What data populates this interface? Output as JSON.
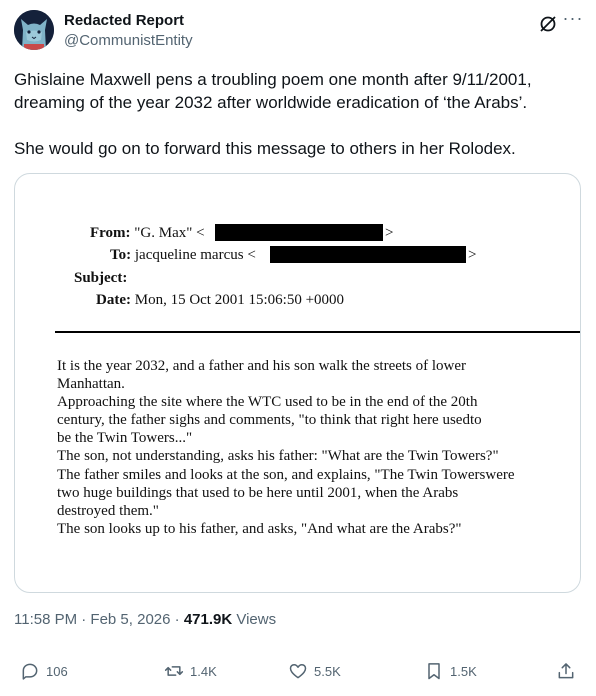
{
  "author": {
    "name": "Redacted Report",
    "handle": "@CommunistEntity"
  },
  "tweet": {
    "text_line1": "Ghislaine Maxwell pens a troubling poem one month after 9/11/2001,",
    "text_line2": "dreaming of the year 2032 after worldwide eradication of ‘the Arabs’.",
    "text_line3": "She would go on to forward this message to others in her Rolodex."
  },
  "email": {
    "from_label": "From:",
    "from_value": "\"G. Max\" <",
    "to_label": "To:",
    "to_value": "jacqueline marcus <",
    "subject_label": "Subject:",
    "date_label": "Date:",
    "date_value": "Mon, 15 Oct 2001 15:06:50 +0000",
    "close_bracket": ">",
    "body_lines": [
      "It is the year 2032, and a father and his son walk the streets of lower",
      "Manhattan.",
      "Approaching the site where the WTC used to be in the end of the 20th",
      "century, the father sighs and comments, \"to think that right here usedto",
      "be the Twin Towers...\"",
      "The son, not understanding, asks his father: \"What are the Twin Towers?\"",
      "The father smiles and looks at the son, and explains, \"The Twin Towerswere",
      "two huge buildings that used to be here until 2001, when the Arabs",
      "destroyed them.\"",
      "The son looks up to his father, and asks, \"And what are the Arabs?\""
    ]
  },
  "meta": {
    "time": "11:58 PM · Feb 5, 2026 · ",
    "views_count": "471.9K",
    "views_label": " Views"
  },
  "actions": {
    "replies": "106",
    "reposts": "1.4K",
    "likes": "5.5K",
    "bookmarks": "1.5K"
  },
  "colors": {
    "text": "#0f1419",
    "secondary": "#536471",
    "border": "#cfd9de",
    "avatar_bg": "#14213a"
  }
}
